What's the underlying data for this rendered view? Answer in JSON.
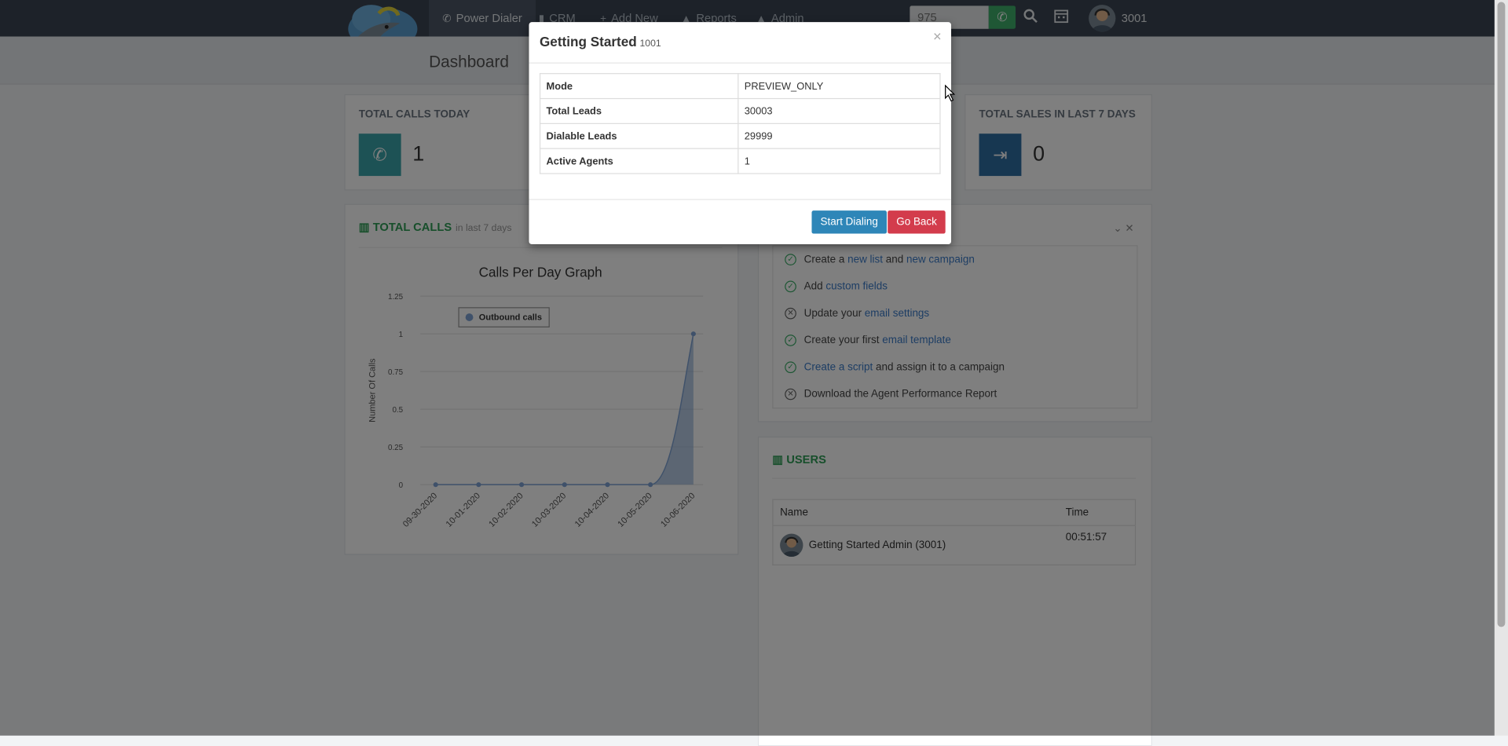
{
  "nav": {
    "items": [
      {
        "label": "Power Dialer",
        "icon": "phone-icon"
      },
      {
        "label": "CRM",
        "icon": "book-icon"
      },
      {
        "label": "Add New",
        "icon": "plus-icon"
      },
      {
        "label": "Reports",
        "icon": "bell-icon"
      },
      {
        "label": "Admin",
        "icon": "bell-icon"
      }
    ],
    "search_value": "975",
    "user_ext": "3001"
  },
  "page_title": "Dashboard",
  "stats": {
    "calls_today": {
      "label": "TOTAL CALLS TODAY",
      "value": "1",
      "color": "#3ba5ab"
    },
    "sales_7d": {
      "label": "TOTAL SALES IN LAST 7 DAYS",
      "value": "0",
      "color": "#2f6ea3"
    }
  },
  "total_calls_panel": {
    "title": "TOTAL CALLS",
    "subtitle": "in last 7 days"
  },
  "chart_data": {
    "type": "area",
    "title": "Calls Per Day Graph",
    "ylabel": "Number Of Calls",
    "xlabel": "",
    "ylim": [
      0,
      1.25
    ],
    "yticks": [
      "0",
      "0.25",
      "0.5",
      "0.75",
      "1",
      "1.25"
    ],
    "categories": [
      "09-30-2020",
      "10-01-2020",
      "10-02-2020",
      "10-03-2020",
      "10-04-2020",
      "10-05-2020",
      "10-06-2020"
    ],
    "series": [
      {
        "name": "Outbound calls",
        "values": [
          0,
          0,
          0,
          0,
          0,
          0,
          1
        ],
        "color": "#7ea3d4"
      }
    ],
    "legend": "top-left"
  },
  "todo": {
    "items": [
      {
        "done": true,
        "pre": "Create a ",
        "link1": "new list",
        "mid": " and ",
        "link2": "new campaign",
        "post": ""
      },
      {
        "done": true,
        "pre": "Add ",
        "link1": "custom fields",
        "mid": "",
        "link2": "",
        "post": ""
      },
      {
        "done": false,
        "pre": "Update your ",
        "link1": "email settings",
        "mid": "",
        "link2": "",
        "post": ""
      },
      {
        "done": true,
        "pre": "Create your first ",
        "link1": "email template",
        "mid": "",
        "link2": "",
        "post": ""
      },
      {
        "done": true,
        "pre": "",
        "link1": "Create a script",
        "mid": "",
        "link2": "",
        "post": " and assign it to a campaign"
      },
      {
        "done": false,
        "pre": "Download the Agent Performance Report",
        "link1": "",
        "mid": "",
        "link2": "",
        "post": ""
      }
    ]
  },
  "users_panel": {
    "title": "USERS",
    "columns": [
      "Name",
      "Time"
    ],
    "rows": [
      {
        "name": "Getting Started Admin (3001)",
        "time": "00:51:57"
      }
    ]
  },
  "modal": {
    "title": "Getting Started",
    "subtitle": "1001",
    "close": "×",
    "rows": [
      {
        "key": "Mode",
        "value": "PREVIEW_ONLY"
      },
      {
        "key": "Total Leads",
        "value": "30003"
      },
      {
        "key": "Dialable Leads",
        "value": "29999"
      },
      {
        "key": "Active Agents",
        "value": "1"
      }
    ],
    "start_label": "Start Dialing",
    "back_label": "Go Back"
  }
}
